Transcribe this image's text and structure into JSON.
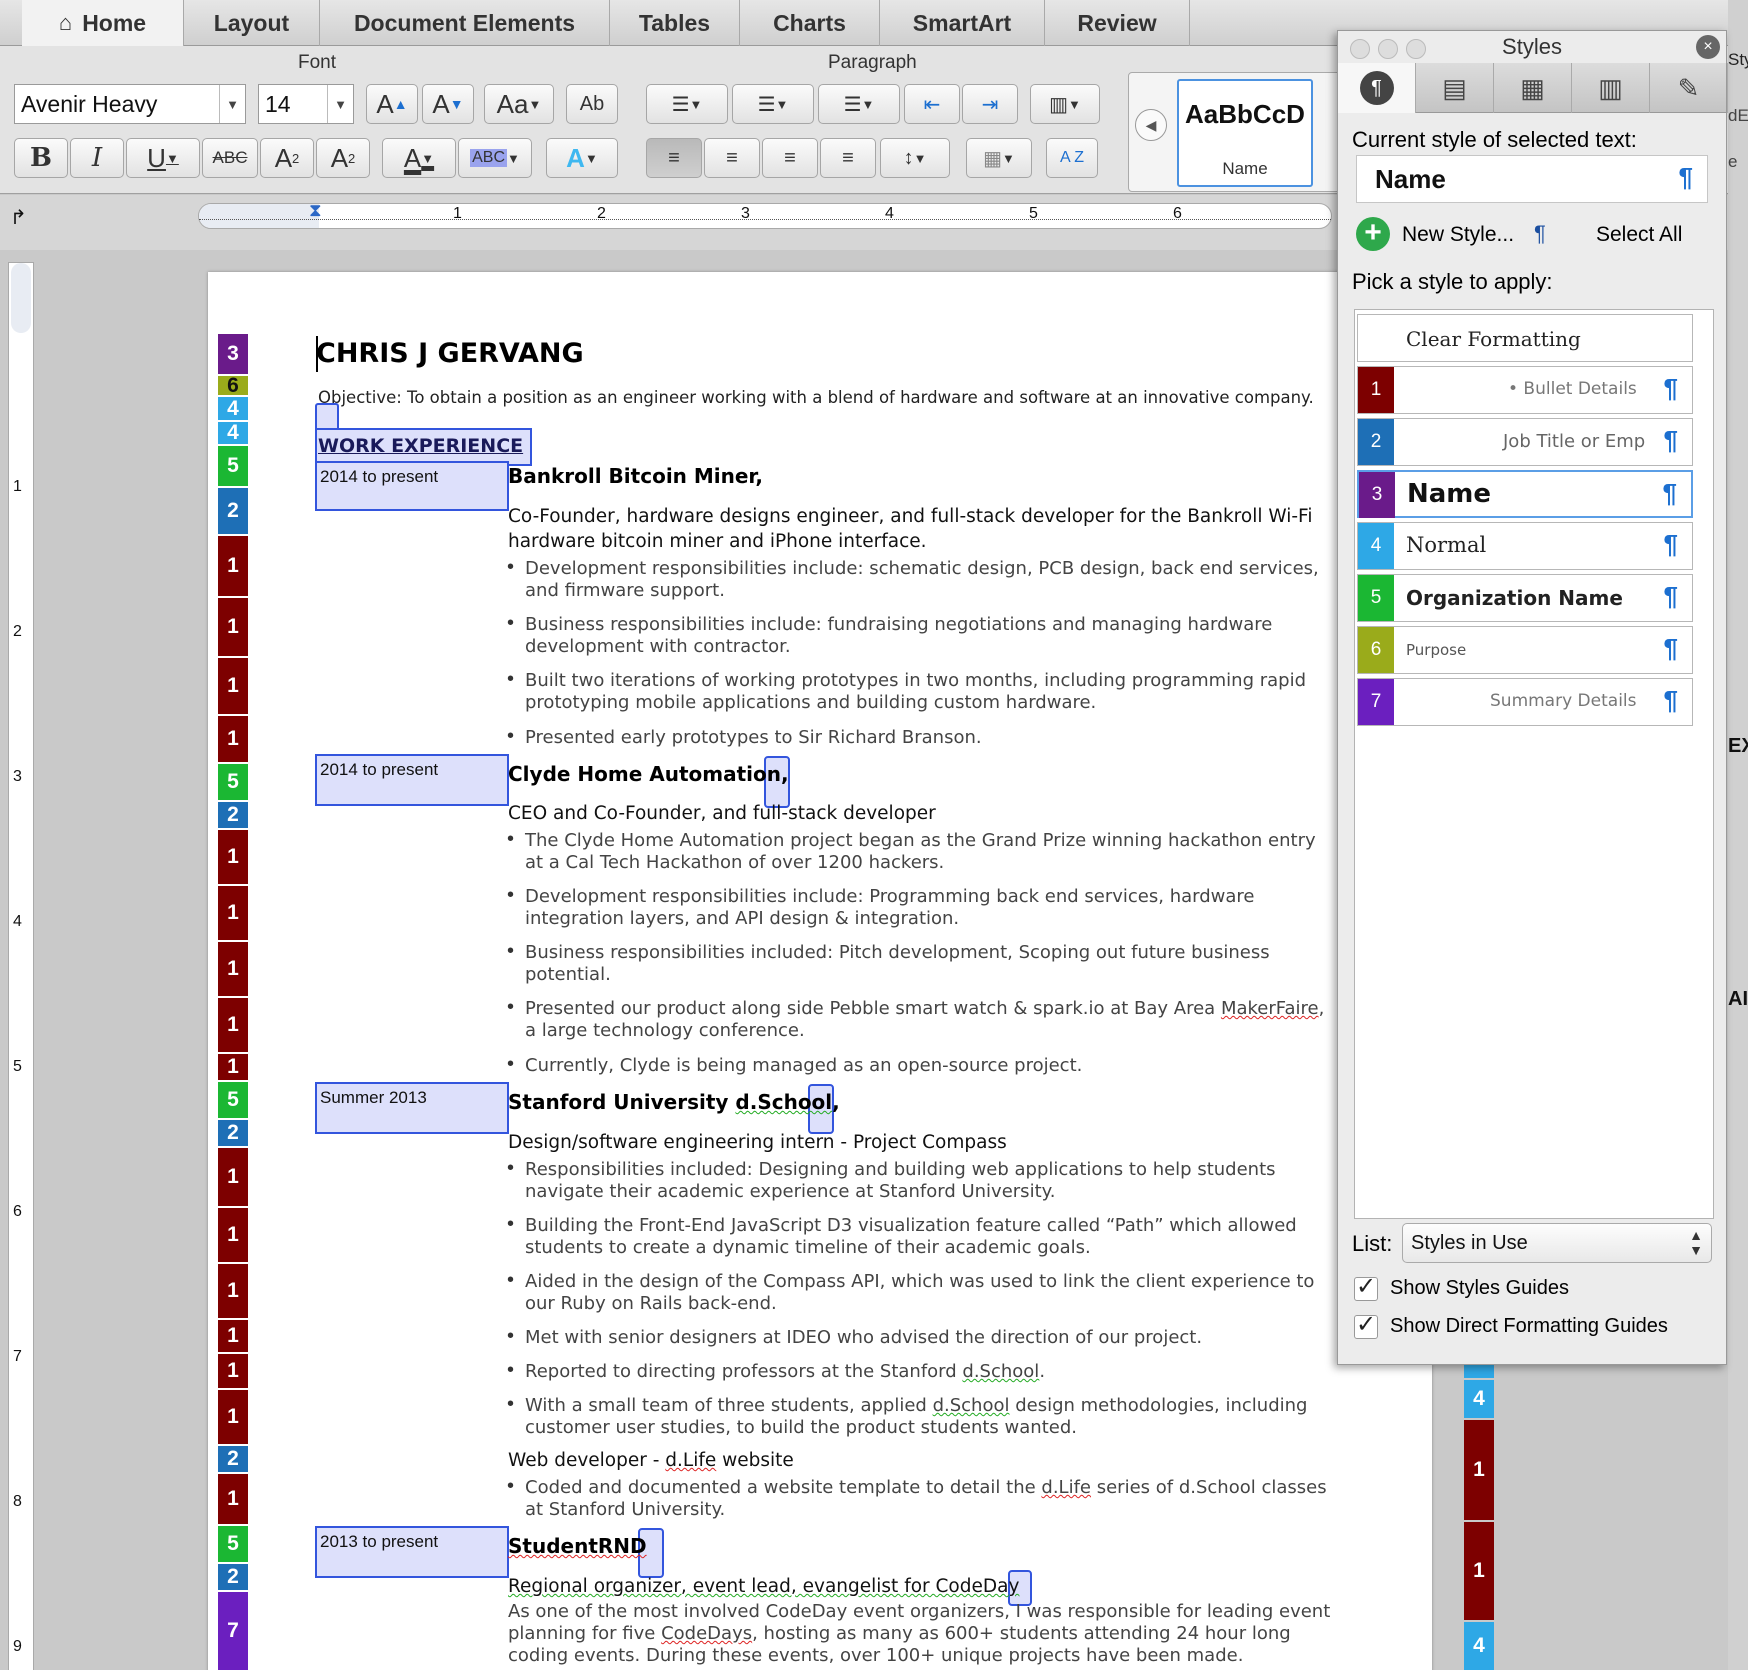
{
  "tabs": [
    "Home",
    "Layout",
    "Document Elements",
    "Tables",
    "Charts",
    "SmartArt",
    "Review"
  ],
  "ribbon": {
    "font_group": "Font",
    "paragraph_group": "Paragraph",
    "font_name": "Avenir Heavy",
    "font_size": "14",
    "style_gallery_sample": "AaBbCcD",
    "style_gallery_name": "Name",
    "b": "B",
    "i": "I",
    "u": "U",
    "abc": "ABC",
    "a": "A",
    "aa": "Aa",
    "ab": "Ab",
    "az": "A Z"
  },
  "ruler": [
    "1",
    "2",
    "3",
    "4",
    "5",
    "6"
  ],
  "vruler": [
    "1",
    "2",
    "3",
    "4",
    "5",
    "6",
    "7",
    "8",
    "9"
  ],
  "doc": {
    "name": "CHRIS J GERVANG",
    "objective": "Objective: To obtain a position as an engineer working with a blend of hardware and software at an innovative company.",
    "section": "WORK EXPERIENCE",
    "jobs": [
      {
        "date": "2014 to present",
        "org": "Bankroll Bitcoin Miner,",
        "title": "Co-Founder, hardware designs engineer, and full-stack developer for the Bankroll Wi-Fi",
        "title2": "hardware bitcoin miner and iPhone interface.",
        "b1a": "Development responsibilities include: schematic design, PCB design, back end services,",
        "b1b": "and firmware support.",
        "b2a": "Business responsibilities include: fundraising negotiations and managing hardware",
        "b2b": "development with contractor.",
        "b3a": "Built two iterations of working prototypes in two months, including programming rapid",
        "b3b": "prototyping mobile applications and building custom hardware.",
        "b4": "Presented early prototypes to Sir Richard Branson."
      },
      {
        "date": "2014 to present",
        "org": "Clyde Home Automation,",
        "title": "CEO and Co-Founder, and full-stack developer",
        "b1a": "The Clyde Home Automation project began as the Grand Prize winning hackathon entry",
        "b1b": "at a Cal Tech Hackathon of over 1200 hackers.",
        "b2a": "Development responsibilities include: Programming back end services, hardware",
        "b2b": "integration layers, and API design & integration.",
        "b3a": "Business responsibilities included: Pitch development, Scoping out future business",
        "b3b": "potential.",
        "b4a": "Presented our product along side Pebble smart watch & spark.io at Bay Area ",
        "b4a_sq": "MakerFaire",
        "b4b": "a large technology conference.",
        "b5": "Currently, Clyde is being managed as an open-source project."
      },
      {
        "date": "Summer 2013",
        "org_a": "Stanford University ",
        "org_sg": "d.School",
        "org_b": ",",
        "title": "Design/software engineering intern - Project Compass",
        "b1a": "Responsibilities included: Designing and building web applications to help students",
        "b1b": "navigate their academic experience at Stanford University.",
        "b2a": "Building the Front-End JavaScript D3 visualization feature called “Path” which allowed",
        "b2b": "students to create a dynamic timeline of their academic goals.",
        "b3a": "Aided in the design of the Compass API, which was used to link the client experience to",
        "b3b": "our Ruby on Rails back-end.",
        "b4": "Met with senior designers at IDEO who advised the direction of our project.",
        "b5a": "Reported to directing professors at the Stanford ",
        "b5_sg": "d.School",
        "b5b": ".",
        "b6a": "With a small team of three students, applied ",
        "b6_sg": "d.School",
        "b6b": " design methodologies, including",
        "b6c": "customer user studies, to build the product students wanted.",
        "title2a": "Web developer - ",
        "title2_sq": "d.Life",
        "title2b": " website",
        "b7a": "Coded and documented a website template to detail the ",
        "b7_sq": "d.Life",
        "b7b": " series of d.School classes",
        "b7c": "at Stanford University."
      },
      {
        "date": "2013 to present",
        "org": "StudentRND",
        "title": "Regional organizer, event lead, evangelist for CodeDay",
        "p1": "As one of the most involved CodeDay event organizers, I was responsible for leading event",
        "p2a": "planning for five ",
        "p2_sq": "CodeDays",
        "p2b": ", hosting as many as 600+ students attending 24 hour long",
        "p3": "coding events. During these events, over 100+ unique projects have been made."
      }
    ]
  },
  "styles_panel": {
    "title": "Styles",
    "current_label": "Current style of selected text:",
    "current_value": "Name",
    "new_style": "New Style...",
    "select_all": "Select All",
    "pick_label": "Pick a style to apply:",
    "clear": "Clear Formatting",
    "items": [
      {
        "num": "1",
        "name": "• Bullet Details",
        "color": "#7d0000"
      },
      {
        "num": "2",
        "name": "Job Title or Emp",
        "color": "#1e6fb6"
      },
      {
        "num": "3",
        "name": "Name",
        "color": "#6a1b8a"
      },
      {
        "num": "4",
        "name": "Normal",
        "color": "#2ea8e6"
      },
      {
        "num": "5",
        "name": "Organization Name",
        "color": "#1bb733"
      },
      {
        "num": "6",
        "name": "Purpose",
        "color": "#9aab1b"
      },
      {
        "num": "7",
        "name": "Summary Details",
        "color": "#6b1fbf"
      }
    ],
    "list_label": "List:",
    "list_value": "Styles in Use",
    "show_guides": "Show Styles Guides",
    "show_direct": "Show Direct Formatting Guides",
    "pilcrow": "¶",
    "dots": "• • •"
  },
  "edge": {
    "styl": "Styl",
    "de": "dE",
    "e": "e",
    "ex": "EX",
    "al": "AI",
    "n4a": "4",
    "n4b": "4",
    "n1a": "1",
    "n1b": "1",
    "n4c": "4"
  },
  "lanes": [
    "3",
    "6",
    "4",
    "4",
    "5",
    "2",
    "1",
    "1",
    "1",
    "1",
    "5",
    "2",
    "1",
    "1",
    "1",
    "1",
    "1",
    "5",
    "2",
    "1",
    "1",
    "1",
    "1",
    "1",
    "1",
    "2",
    "1",
    "5",
    "2",
    "7"
  ]
}
